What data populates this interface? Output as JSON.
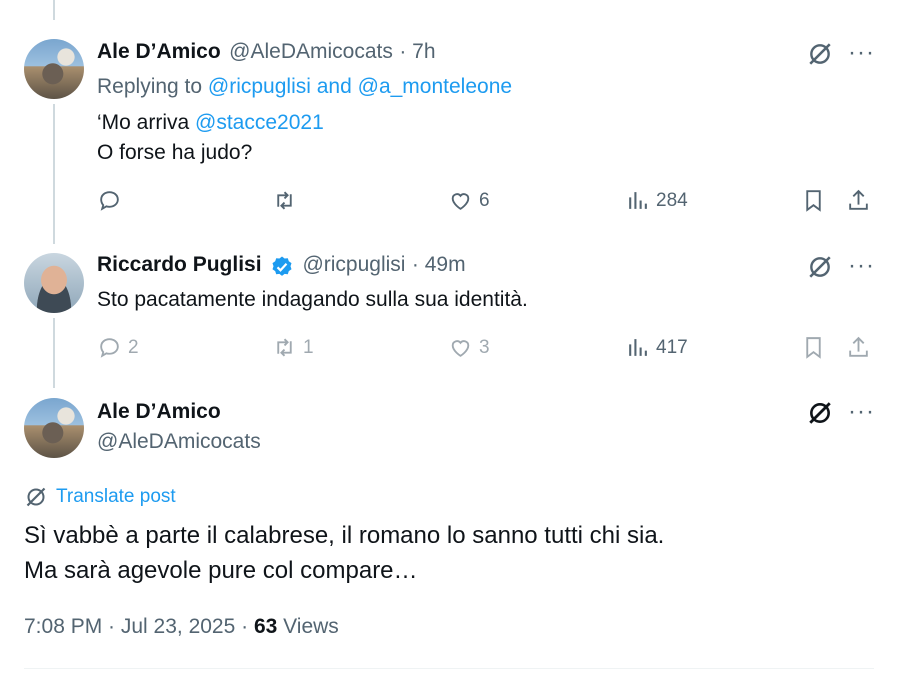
{
  "reply1": {
    "name": "Ale D’Amico",
    "handle": "@AleDAmicocats",
    "time": "· 7h",
    "replying_prefix": "Replying to",
    "replying_to": "@ricpuglisi and @a_monteleone",
    "line1_prefix": "‘Mo arriva ",
    "line1_mention": "@stacce2021",
    "line2": "O forse ha judo?",
    "likes": "6",
    "views": "284"
  },
  "reply2": {
    "name": "Riccardo Puglisi",
    "handle": "@ricpuglisi",
    "time": "· 49m",
    "text": "Sto pacatamente indagando sulla sua identità.",
    "replies": "2",
    "reposts": "1",
    "likes": "3",
    "views": "417"
  },
  "main": {
    "name": "Ale D’Amico",
    "handle": "@AleDAmicocats",
    "translate_label": "Translate post",
    "line1": "Sì vabbè a parte il calabrese, il romano lo sanno tutti chi sia.",
    "line2": "Ma sarà agevole pure col compare…",
    "timestamp": "7:08 PM · Jul 23, 2025 ·",
    "views_count": "63",
    "views_label": "Views"
  },
  "icons": {
    "more": "more-dots-icon",
    "grok": "grok-icon",
    "reply": "reply-icon",
    "repost": "repost-icon",
    "like": "heart-icon",
    "views": "views-icon",
    "bookmark": "bookmark-icon",
    "share": "share-icon",
    "verified": "verified-badge-icon"
  },
  "colors": {
    "link": "#1d9bf0",
    "text": "#0f1419",
    "secondary": "#536471"
  }
}
